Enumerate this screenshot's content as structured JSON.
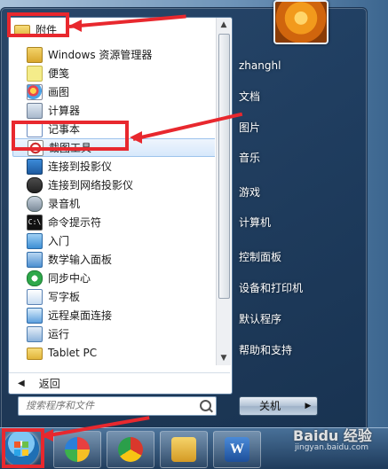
{
  "start_menu": {
    "programs": [
      {
        "label": "附件",
        "icon": "folder-icon",
        "kind": "folder"
      },
      {
        "label": "Windows 资源管理器",
        "icon": "explorer-icon"
      },
      {
        "label": "便笺",
        "icon": "sticky-notes-icon"
      },
      {
        "label": "画图",
        "icon": "paint-icon"
      },
      {
        "label": "计算器",
        "icon": "calculator-icon"
      },
      {
        "label": "记事本",
        "icon": "notepad-icon"
      },
      {
        "label": "截图工具",
        "icon": "snipping-tool-icon",
        "selected": true
      },
      {
        "label": "连接到投影仪",
        "icon": "projector-icon"
      },
      {
        "label": "连接到网络投影仪",
        "icon": "network-projector-icon"
      },
      {
        "label": "录音机",
        "icon": "sound-recorder-icon"
      },
      {
        "label": "命令提示符",
        "icon": "command-prompt-icon",
        "glyph": "C:\\"
      },
      {
        "label": "入门",
        "icon": "getting-started-icon"
      },
      {
        "label": "数学输入面板",
        "icon": "math-input-icon"
      },
      {
        "label": "同步中心",
        "icon": "sync-center-icon"
      },
      {
        "label": "写字板",
        "icon": "wordpad-icon"
      },
      {
        "label": "远程桌面连接",
        "icon": "remote-desktop-icon"
      },
      {
        "label": "运行",
        "icon": "run-icon"
      },
      {
        "label": "Tablet PC",
        "icon": "folder-icon",
        "kind": "folder"
      }
    ],
    "back_label": "返回",
    "search": {
      "placeholder": "搜索程序和文件"
    },
    "right_items": [
      {
        "label": "zhanghl",
        "name": "user-name"
      },
      {
        "label": "文档",
        "name": "documents"
      },
      {
        "label": "图片",
        "name": "pictures"
      },
      {
        "label": "音乐",
        "name": "music"
      },
      {
        "label": "游戏",
        "name": "games"
      },
      {
        "label": "计算机",
        "name": "computer"
      },
      {
        "label": "控制面板",
        "name": "control-panel"
      },
      {
        "label": "设备和打印机",
        "name": "devices-printers"
      },
      {
        "label": "默认程序",
        "name": "default-programs"
      },
      {
        "label": "帮助和支持",
        "name": "help-support"
      }
    ],
    "shutdown_label": "关机"
  },
  "taskbar": {
    "items": [
      {
        "name": "pinwheel-app-icon"
      },
      {
        "name": "chrome-icon"
      },
      {
        "name": "file-explorer-icon"
      },
      {
        "name": "word-icon",
        "glyph": "W"
      }
    ]
  },
  "watermark": {
    "main": "Baidu 经验",
    "sub": "jingyan.baidu.com"
  },
  "colors": {
    "callout": "#e8282e",
    "selected_bg": "#d7e8fb"
  }
}
